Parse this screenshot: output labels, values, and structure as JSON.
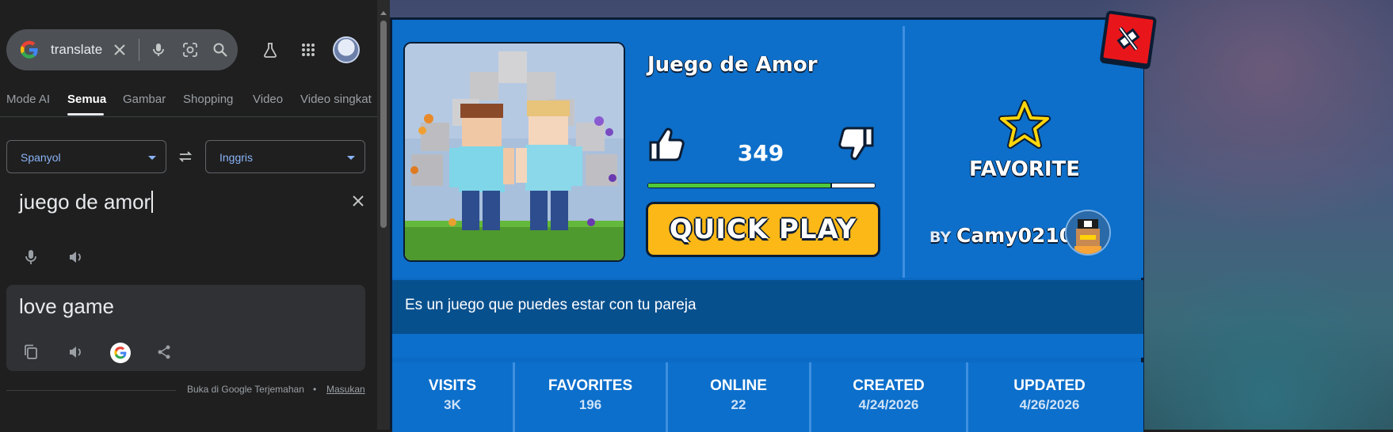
{
  "search": {
    "query": "translate",
    "tabs": [
      {
        "label": "Mode AI"
      },
      {
        "label": "Semua"
      },
      {
        "label": "Gambar"
      },
      {
        "label": "Shopping"
      },
      {
        "label": "Video"
      },
      {
        "label": "Video singkat"
      }
    ],
    "active_tab": "Semua"
  },
  "translator": {
    "source_lang": "Spanyol",
    "target_lang": "Inggris",
    "source_text": "juego de amor",
    "result_text": "love game",
    "footer_open": "Buka di Google Terjemahan",
    "footer_sep": "•",
    "footer_feedback": "Masukan"
  },
  "game": {
    "title": "Juego de Amor",
    "likes": "349",
    "like_ratio": 0.81,
    "quick_play": "QUICK PLAY",
    "favorite": "FAVORITE",
    "by": "BY",
    "creator": "Camy0210",
    "description": "Es un juego que puedes estar con tu pareja",
    "stats": [
      {
        "label": "VISITS",
        "value": "3K"
      },
      {
        "label": "FAVORITES",
        "value": "196"
      },
      {
        "label": "ONLINE",
        "value": "22"
      },
      {
        "label": "CREATED",
        "value": "4/24/2026"
      },
      {
        "label": "UPDATED",
        "value": "4/26/2026"
      }
    ]
  },
  "colors": {
    "accent_blue": "#8ab4f8",
    "modal_blue": "#0d6fc9",
    "play_yellow": "#fcb816",
    "like_green": "#4fc93b",
    "close_red": "#e8161b",
    "star_yellow": "#ffd60a"
  }
}
